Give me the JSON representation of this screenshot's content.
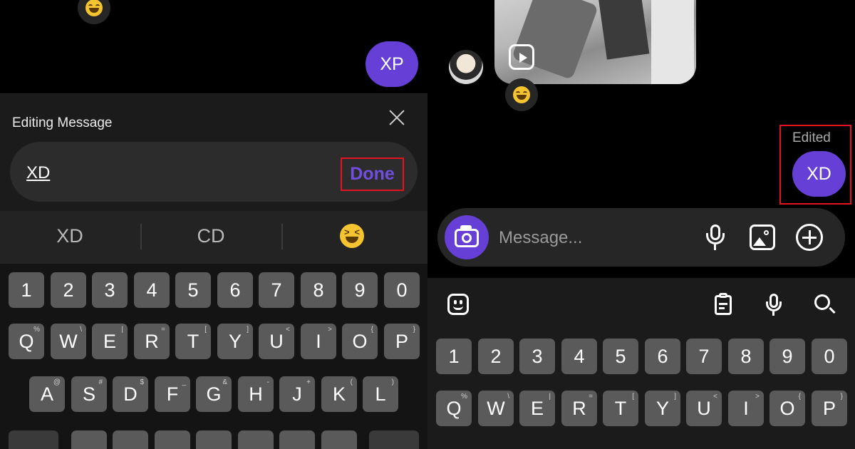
{
  "left": {
    "edit_panel": {
      "title": "Editing Message",
      "field_value": "XD",
      "done_label": "Done"
    },
    "sent_bubble": "XP",
    "suggestions": [
      "XD",
      "CD"
    ]
  },
  "right": {
    "edited_label": "Edited",
    "sent_bubble": "XD",
    "composer": {
      "placeholder": "Message..."
    }
  },
  "keyboard": {
    "numbers": [
      "1",
      "2",
      "3",
      "4",
      "5",
      "6",
      "7",
      "8",
      "9",
      "0"
    ],
    "row_qwerty": [
      {
        "k": "Q",
        "s": "%"
      },
      {
        "k": "W",
        "s": "\\"
      },
      {
        "k": "E",
        "s": "|"
      },
      {
        "k": "R",
        "s": "="
      },
      {
        "k": "T",
        "s": "["
      },
      {
        "k": "Y",
        "s": "]"
      },
      {
        "k": "U",
        "s": "<"
      },
      {
        "k": "I",
        "s": ">"
      },
      {
        "k": "O",
        "s": "{"
      },
      {
        "k": "P",
        "s": "}"
      }
    ],
    "row_asdf": [
      {
        "k": "A",
        "s": "@"
      },
      {
        "k": "S",
        "s": "#"
      },
      {
        "k": "D",
        "s": "$"
      },
      {
        "k": "F",
        "s": "_"
      },
      {
        "k": "G",
        "s": "&"
      },
      {
        "k": "H",
        "s": "-"
      },
      {
        "k": "J",
        "s": "+"
      },
      {
        "k": "K",
        "s": "("
      },
      {
        "k": "L",
        "s": ")"
      }
    ]
  },
  "colors": {
    "accent": "#6640d6",
    "done_text": "#6f4ee0",
    "highlight_box": "#e2131e",
    "key": "#5a5a5a"
  },
  "icons": [
    "close-icon",
    "camera-icon",
    "microphone-icon",
    "image-icon",
    "plus-icon",
    "sticker-icon",
    "clipboard-icon",
    "search-icon",
    "laughing-emoji-icon",
    "reels-icon"
  ]
}
